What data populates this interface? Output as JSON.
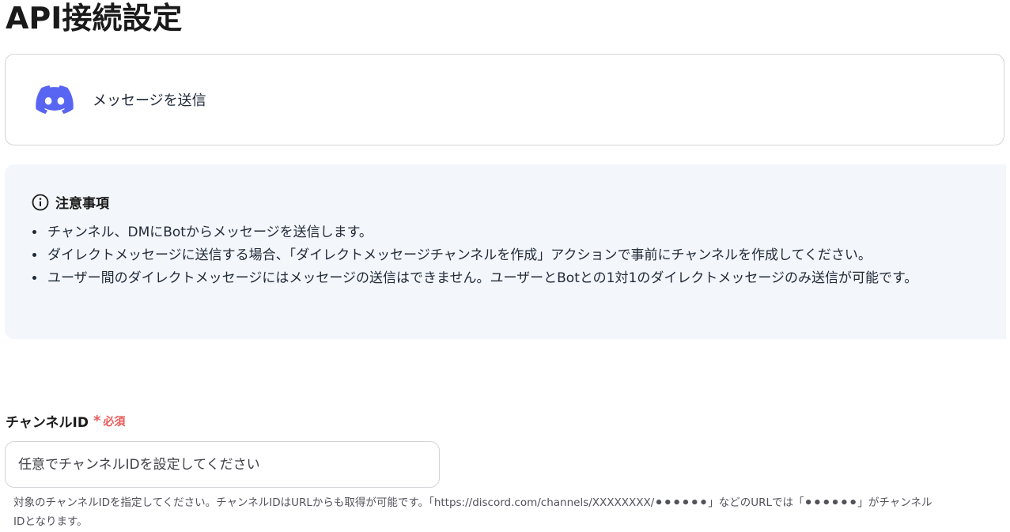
{
  "page": {
    "title": "API接続設定"
  },
  "action": {
    "icon": "discord-icon",
    "label": "メッセージを送信",
    "brand_color": "#5865F2"
  },
  "notice": {
    "icon": "info-icon",
    "title": "注意事項",
    "items": [
      "チャンネル、DMにBotからメッセージを送信します。",
      "ダイレクトメッセージに送信する場合、「ダイレクトメッセージチャンネルを作成」アクションで事前にチャンネルを作成してください。",
      "ユーザー間のダイレクトメッセージにはメッセージの送信はできません。ユーザーとBotとの1対1のダイレクトメッセージのみ送信が可能です。"
    ]
  },
  "channel_field": {
    "label": "チャンネルID",
    "required_mark": "*",
    "required_text": "必須",
    "placeholder": "任意でチャンネルIDを設定してください",
    "value": "",
    "help": "対象のチャンネルIDを指定してください。チャンネルIDはURLからも取得が可能です。「https://discord.com/channels/XXXXXXXX/⚫⚫⚫⚫⚫⚫」などのURLでは「⚫⚫⚫⚫⚫⚫」がチャンネルIDとなります。"
  },
  "colors": {
    "required": "#e85a5a",
    "notice_bg": "#f3f6fa",
    "border": "#d4d4d8"
  }
}
